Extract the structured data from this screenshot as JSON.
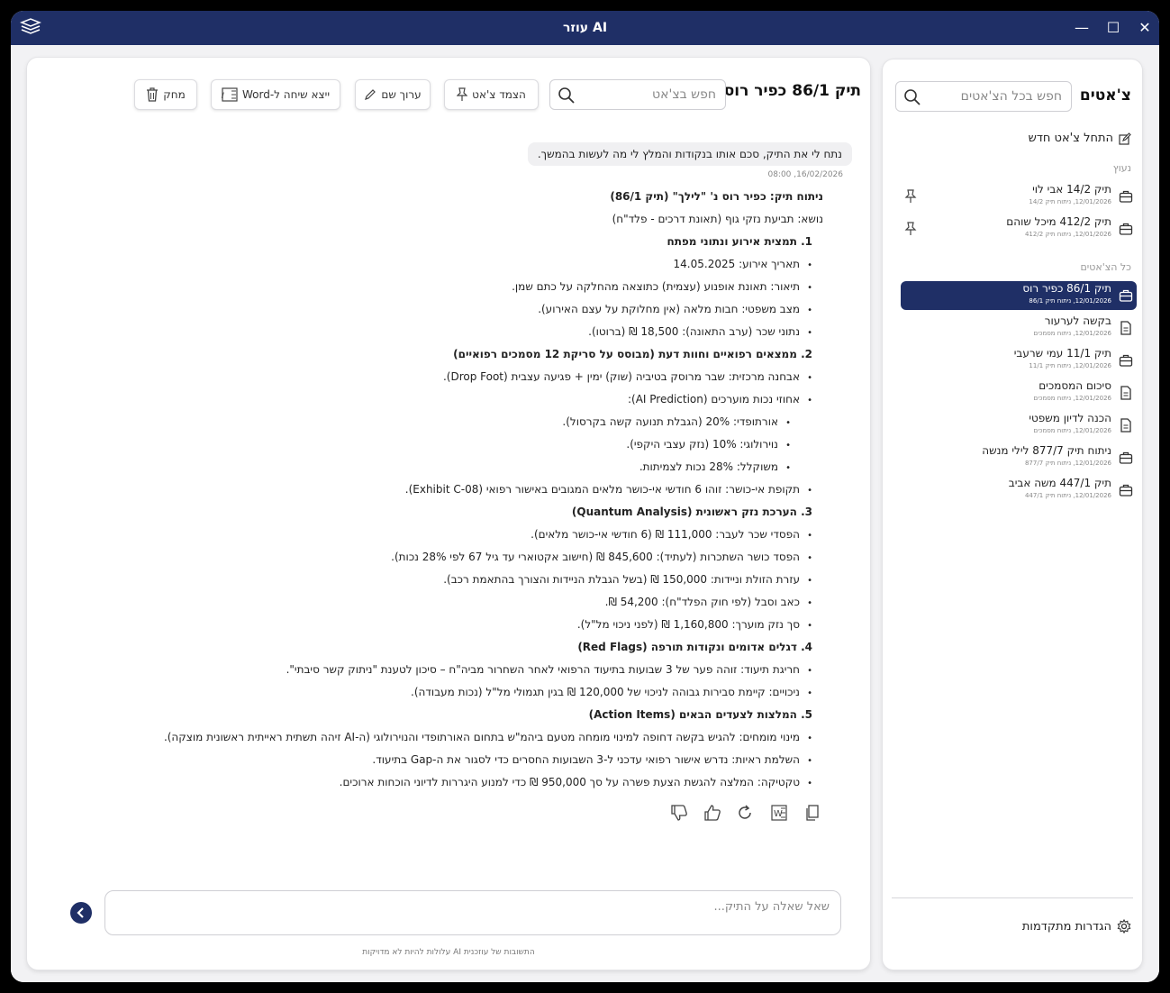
{
  "window": {
    "title": "עוזר AI",
    "minimize_label": "—",
    "maximize_label": "☐",
    "close_label": "✕"
  },
  "chat": {
    "title": "תיק 86/1 כפיר רוס",
    "search_placeholder": "חפש בצ'אט",
    "toolbar": {
      "pin_label": "הצמד צ'אט",
      "rename_label": "ערוך שם",
      "export_label": "ייצא שיחה ל-Word",
      "delete_label": "מחק"
    },
    "user_message": {
      "text": "נתח לי את התיק, סכם אותו בנקודות והמלץ לי מה לעשות בהמשך.",
      "timestamp": "08:00 ,16/02/2026"
    },
    "answer_lines": [
      {
        "text": "ניתוח תיק: כפיר רוס נ' \"לילך\" (תיק 86/1)",
        "bold": true,
        "level": 0,
        "bullet": false
      },
      {
        "text": "נושא: תביעת נזקי גוף (תאונת דרכים - פלד\"ח)",
        "bold": false,
        "level": 0,
        "bullet": false
      },
      {
        "text": "1. תמצית אירוע ונתוני מפתח",
        "bold": true,
        "level": 1,
        "bullet": false
      },
      {
        "text": "תאריך אירוע: 14.05.2025",
        "bold": false,
        "level": 1,
        "bullet": true
      },
      {
        "text": "תיאור: תאונת אופנוע (עצמית) כתוצאה מהחלקה על כתם שמן.",
        "bold": false,
        "level": 1,
        "bullet": true
      },
      {
        "text": "מצב משפטי: חבות מלאה (אין מחלוקת על עצם האירוע).",
        "bold": false,
        "level": 1,
        "bullet": true
      },
      {
        "text": "נתוני שכר (ערב התאונה): 18,500 ₪ (ברוטו).",
        "bold": false,
        "level": 1,
        "bullet": true
      },
      {
        "text": "2. ממצאים רפואיים וחוות דעת (מבוסס על סריקת 12 מסמכים רפואיים)",
        "bold": true,
        "level": 1,
        "bullet": false
      },
      {
        "text": "אבחנה מרכזית: שבר מרוסק בטיביה (שוק) ימין + פגיעה עצבית (Drop Foot).",
        "bold": false,
        "level": 1,
        "bullet": true
      },
      {
        "text": "אחוזי נכות מוערכים (AI Prediction):",
        "bold": false,
        "level": 1,
        "bullet": true
      },
      {
        "text": "אורתופדי: 20% (הגבלת תנועה קשה בקרסול).",
        "bold": false,
        "level": 2,
        "bullet": true
      },
      {
        "text": "נוירולוגי: 10% (נזק עצבי היקפי).",
        "bold": false,
        "level": 2,
        "bullet": true
      },
      {
        "text": "משוקלל: 28% נכות לצמיתות.",
        "bold": false,
        "level": 2,
        "bullet": true
      },
      {
        "text": "תקופת אי-כושר: זוהו 6 חודשי אי-כושר מלאים המגובים באישור רפואי (Exhibit C-08).",
        "bold": false,
        "level": 1,
        "bullet": true
      },
      {
        "text": "3. הערכת נזק ראשונית (Quantum Analysis)",
        "bold": true,
        "level": 1,
        "bullet": false
      },
      {
        "text": "הפסדי שכר לעבר: 111,000 ₪ (6 חודשי אי-כושר מלאים).",
        "bold": false,
        "level": 1,
        "bullet": true
      },
      {
        "text": "הפסד כושר השתכרות (לעתיד): 845,600 ₪ (חישוב אקטוארי עד גיל 67 לפי 28% נכות).",
        "bold": false,
        "level": 1,
        "bullet": true
      },
      {
        "text": "עזרת הזולת וניידות: 150,000 ₪ (בשל הגבלת הניידות והצורך בהתאמת רכב).",
        "bold": false,
        "level": 1,
        "bullet": true
      },
      {
        "text": "כאב וסבל (לפי חוק הפלד\"ח): 54,200 ₪.",
        "bold": false,
        "level": 1,
        "bullet": true
      },
      {
        "text": "סך נזק מוערך: 1,160,800 ₪ (לפני ניכוי מל\"ל).",
        "bold": false,
        "level": 1,
        "bullet": true
      },
      {
        "text": "4. דגלים אדומים ונקודות תורפה (Red Flags)",
        "bold": true,
        "level": 1,
        "bullet": false
      },
      {
        "text": "חריגת תיעוד: זוהה פער של 3 שבועות בתיעוד הרפואי לאחר השחרור מביה\"ח – סיכון לטענת \"ניתוק קשר סיבתי\".",
        "bold": false,
        "level": 1,
        "bullet": true
      },
      {
        "text": "ניכויים: קיימת סבירות גבוהה לניכוי של 120,000 ₪ בגין תגמולי מל\"ל (נכות מעבודה).",
        "bold": false,
        "level": 1,
        "bullet": true
      },
      {
        "text": "5. המלצות לצעדים הבאים (Action Items)",
        "bold": true,
        "level": 1,
        "bullet": false
      },
      {
        "text": "מינוי מומחים: להגיש בקשה דחופה למינוי מומחה מטעם ביהמ\"ש בתחום האורתופדי והנוירולוגי (ה-AI זיהה תשתית ראייתית ראשונית מוצקה).",
        "bold": false,
        "level": 1,
        "bullet": true
      },
      {
        "text": "השלמת ראיות: נדרש אישור רפואי עדכני ל-3 השבועות החסרים כדי לסגור את ה-Gap בתיעוד.",
        "bold": false,
        "level": 1,
        "bullet": true
      },
      {
        "text": "טקטיקה: המלצה להגשת הצעת פשרה על סך 950,000 ₪ כדי למנוע היגררות לדיוני הוכחות ארוכים.",
        "bold": false,
        "level": 1,
        "bullet": true
      }
    ],
    "input_placeholder": "שאל שאלה על התיק...",
    "disclaimer": "התשובות של עוזכנית AI עלולות להיות לא מדויקות"
  },
  "sidebar": {
    "title": "צ'אטים",
    "search_placeholder": "חפש בכל הצ'אטים",
    "new_chat_label": "התחל צ'אט חדש",
    "pinned_label": "נעוץ",
    "all_label": "כל הצ'אטים",
    "pinned": [
      {
        "name": "תיק 14/2 אבי לוי",
        "meta": "12/01/2026, ניתוח תיק 14/2",
        "icon": "briefcase-icon"
      },
      {
        "name": "תיק 412/2 מיכל שוהם",
        "meta": "12/01/2026, ניתוח תיק 412/2",
        "icon": "briefcase-icon"
      }
    ],
    "chats": [
      {
        "name": "תיק 86/1 כפיר רוס",
        "meta": "12/01/2026, ניתוח תיק 86/1",
        "icon": "briefcase-icon",
        "active": true
      },
      {
        "name": "בקשה לערעור",
        "meta": "12/01/2026, ניתוח מסמכים",
        "icon": "document-icon",
        "active": false
      },
      {
        "name": "תיק 11/1 עמי שרעבי",
        "meta": "12/01/2026, ניתוח תיק 11/1",
        "icon": "briefcase-icon",
        "active": false
      },
      {
        "name": "סיכום המסמכים",
        "meta": "12/01/2026, ניתוח מסמכים",
        "icon": "document-icon",
        "active": false
      },
      {
        "name": "הכנה לדיון משפטי",
        "meta": "12/01/2026, ניתוח מסמכים",
        "icon": "document-icon",
        "active": false
      },
      {
        "name": "ניתוח תיק 877/7 לילי מנשה",
        "meta": "12/01/2026, ניתוח תיק 877/7",
        "icon": "briefcase-icon",
        "active": false
      },
      {
        "name": "תיק 447/1 משה אביב",
        "meta": "12/01/2026, ניתוח תיק 447/1",
        "icon": "briefcase-icon",
        "active": false
      }
    ],
    "settings_label": "הגדרות מתקדמות"
  },
  "colors": {
    "brand": "#1f2f66",
    "active_item": "#1f2f66"
  }
}
